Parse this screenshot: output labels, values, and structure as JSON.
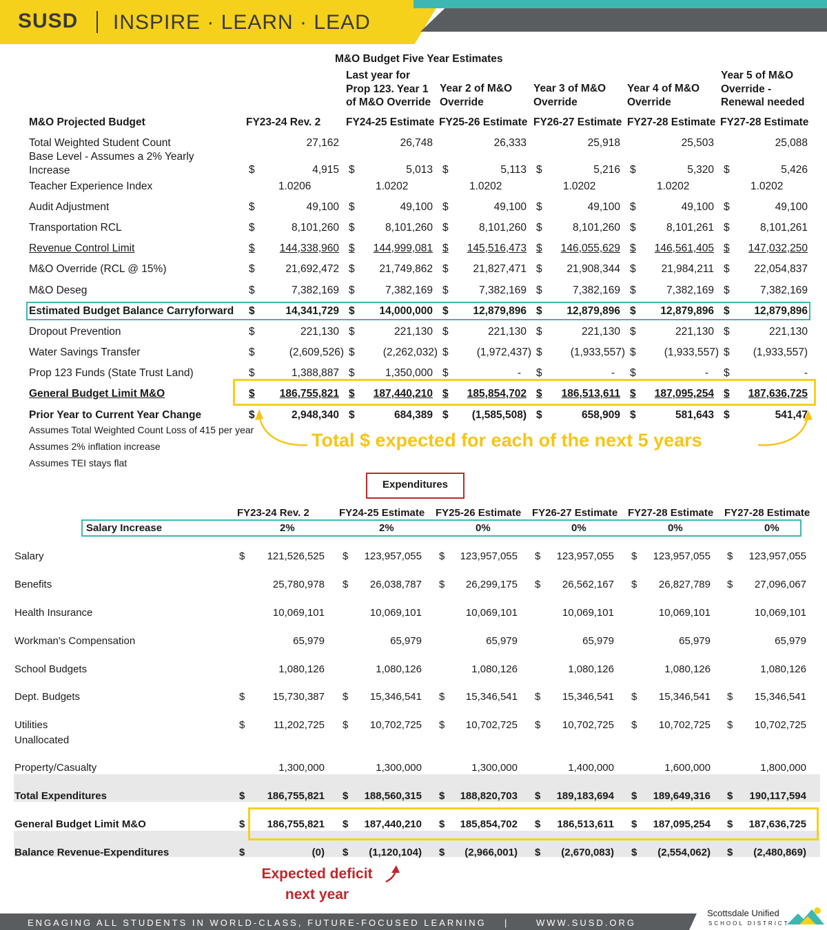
{
  "header": {
    "logo": "SUSD",
    "tagline": "INSPIRE · LEARN · LEAD"
  },
  "revenue": {
    "title": "M&O Budget Five Year Estimates",
    "notes": [
      "Last year for\nProp 123. Year 1\nof M&O Override",
      "Year 2 of M&O\nOverride",
      "Year 3 of M&O\nOverride",
      "Year 4 of M&O\nOverride",
      "Year 5 of M&O\nOverride -\nRenewal needed"
    ],
    "row_header": "M&O Projected Budget",
    "columns": [
      "FY23-24 Rev. 2",
      "FY24-25 Estimate",
      "FY25-26 Estimate",
      "FY26-27 Estimate",
      "FY27-28 Estimate",
      "FY27-28 Estimate"
    ],
    "rows": [
      {
        "label": "Total Weighted Student Count",
        "dollar": false,
        "values": [
          "27,162",
          "26,748",
          "26,333",
          "25,918",
          "25,503",
          "25,088"
        ]
      },
      {
        "label": "Base Level - Assumes a 2% Yearly\nIncrease",
        "dollar": true,
        "values": [
          "4,915",
          "5,013",
          "5,113",
          "5,216",
          "5,320",
          "5,426"
        ]
      },
      {
        "label": "Teacher Experience Index",
        "dollar": false,
        "values": [
          "1.0206",
          "1.0202",
          "1.0202",
          "1.0202",
          "1.0202",
          "1.0202"
        ]
      },
      {
        "label": "Audit Adjustment",
        "dollar": true,
        "values": [
          "49,100",
          "49,100",
          "49,100",
          "49,100",
          "49,100",
          "49,100"
        ]
      },
      {
        "label": "Transportation RCL",
        "dollar": true,
        "values": [
          "8,101,260",
          "8,101,260",
          "8,101,260",
          "8,101,260",
          "8,101,261",
          "8,101,261"
        ]
      },
      {
        "label": "Revenue Control Limit",
        "dollar": true,
        "values": [
          "144,338,960",
          "144,999,081",
          "145,516,473",
          "146,055,629",
          "146,561,405",
          "147,032,250"
        ]
      },
      {
        "label": "M&O Override (RCL @ 15%)",
        "dollar": true,
        "values": [
          "21,692,472",
          "21,749,862",
          "21,827,471",
          "21,908,344",
          "21,984,211",
          "22,054,837"
        ]
      },
      {
        "label": "M&O Deseg",
        "dollar": true,
        "values": [
          "7,382,169",
          "7,382,169",
          "7,382,169",
          "7,382,169",
          "7,382,169",
          "7,382,169"
        ]
      },
      {
        "label": "Estimated Budget Balance Carryforward",
        "dollar": true,
        "values": [
          "14,341,729",
          "14,000,000",
          "12,879,896",
          "12,879,896",
          "12,879,896",
          "12,879,896"
        ]
      },
      {
        "label": "Dropout Prevention",
        "dollar": true,
        "values": [
          "221,130",
          "221,130",
          "221,130",
          "221,130",
          "221,130",
          "221,130"
        ]
      },
      {
        "label": "Water Savings Transfer",
        "dollar": true,
        "values": [
          "(2,609,526)",
          "(2,262,032)",
          "(1,972,437)",
          "(1,933,557)",
          "(1,933,557)",
          "(1,933,557)"
        ]
      },
      {
        "label": "Prop 123 Funds (State Trust Land)",
        "dollar": true,
        "values": [
          "1,388,887",
          "1,350,000",
          "-",
          "-",
          "-",
          "-"
        ]
      },
      {
        "label": "General Budget Limit M&O",
        "dollar": true,
        "values": [
          "186,755,821",
          "187,440,210",
          "185,854,702",
          "186,513,611",
          "187,095,254",
          "187,636,725"
        ]
      },
      {
        "label": "Prior Year to Current Year Change",
        "dollar": true,
        "values": [
          "2,948,340",
          "684,389",
          "(1,585,508)",
          "658,909",
          "581,643",
          "541,47"
        ]
      }
    ],
    "assumptions": [
      "Assumes Total Weighted Count Loss of 415 per year",
      "Assumes 2% inflation increase",
      "Assumes TEI stays flat"
    ],
    "callout": "Total $ expected for each of the next 5 years"
  },
  "expenditures": {
    "title": "Expenditures",
    "columns": [
      "FY23-24 Rev. 2",
      "FY24-25 Estimate",
      "FY25-26 Estimate",
      "FY26-27 Estimate",
      "FY27-28 Estimate",
      "FY27-28 Estimate"
    ],
    "salary_increase": {
      "label": "Salary Increase",
      "values": [
        "2%",
        "2%",
        "0%",
        "0%",
        "0%",
        "0%"
      ]
    },
    "rows": [
      {
        "label": "Salary",
        "dollars": [
          true,
          true,
          true,
          true,
          true,
          true
        ],
        "values": [
          "121,526,525",
          "123,957,055",
          "123,957,055",
          "123,957,055",
          "123,957,055",
          "123,957,055"
        ]
      },
      {
        "label": "Benefits",
        "dollars": [
          false,
          true,
          true,
          true,
          true,
          true
        ],
        "values": [
          "25,780,978",
          "26,038,787",
          "26,299,175",
          "26,562,167",
          "26,827,789",
          "27,096,067"
        ]
      },
      {
        "label": "Health Insurance",
        "dollars": [
          false,
          false,
          false,
          false,
          false,
          false
        ],
        "values": [
          "10,069,101",
          "10,069,101",
          "10,069,101",
          "10,069,101",
          "10,069,101",
          "10,069,101"
        ]
      },
      {
        "label": "Workman's Compensation",
        "dollars": [
          false,
          false,
          false,
          false,
          false,
          false
        ],
        "values": [
          "65,979",
          "65,979",
          "65,979",
          "65,979",
          "65,979",
          "65,979"
        ]
      },
      {
        "label": "School Budgets",
        "dollars": [
          false,
          false,
          false,
          false,
          false,
          false
        ],
        "values": [
          "1,080,126",
          "1,080,126",
          "1,080,126",
          "1,080,126",
          "1,080,126",
          "1,080,126"
        ]
      },
      {
        "label": "Dept. Budgets",
        "dollars": [
          true,
          true,
          true,
          true,
          true,
          true
        ],
        "values": [
          "15,730,387",
          "15,346,541",
          "15,346,541",
          "15,346,541",
          "15,346,541",
          "15,346,541"
        ]
      },
      {
        "label": "Utilities\nUnallocated",
        "dollars": [
          true,
          true,
          true,
          true,
          true,
          true
        ],
        "values": [
          "11,202,725",
          "10,702,725",
          "10,702,725",
          "10,702,725",
          "10,702,725",
          "10,702,725"
        ]
      },
      {
        "label": "Property/Casualty",
        "dollars": [
          false,
          false,
          false,
          false,
          false,
          false
        ],
        "values": [
          "1,300,000",
          "1,300,000",
          "1,300,000",
          "1,400,000",
          "1,600,000",
          "1,800,000"
        ]
      },
      {
        "label": "Total Expenditures",
        "dollars": [
          true,
          true,
          true,
          true,
          true,
          true
        ],
        "values": [
          "186,755,821",
          "188,560,315",
          "188,820,703",
          "189,183,694",
          "189,649,316",
          "190,117,594"
        ]
      },
      {
        "label": "General Budget Limit M&O",
        "dollars": [
          true,
          true,
          true,
          true,
          true,
          true
        ],
        "values": [
          "186,755,821",
          "187,440,210",
          "185,854,702",
          "186,513,611",
          "187,095,254",
          "187,636,725"
        ]
      },
      {
        "label": "Balance Revenue-Expenditures",
        "dollars": [
          true,
          true,
          true,
          true,
          true,
          true
        ],
        "values": [
          "(0)",
          "(1,120,104)",
          "(2,966,001)",
          "(2,670,083)",
          "(2,554,062)",
          "(2,480,869)"
        ]
      }
    ],
    "callout": "Expected deficit\nnext year"
  },
  "footer": {
    "text": "ENGAGING ALL STUDENTS IN WORLD-CLASS, FUTURE-FOCUSED LEARNING",
    "sep": "|",
    "url": "WWW.SUSD.ORG",
    "logo_name": "Scottsdale Unified",
    "logo_sub": "SCHOOL DISTRICT"
  },
  "colors": {
    "yellow": "#f5d11c",
    "teal": "#3eb7b2",
    "red": "#c0272d",
    "dark_grey": "#5a5d60"
  }
}
